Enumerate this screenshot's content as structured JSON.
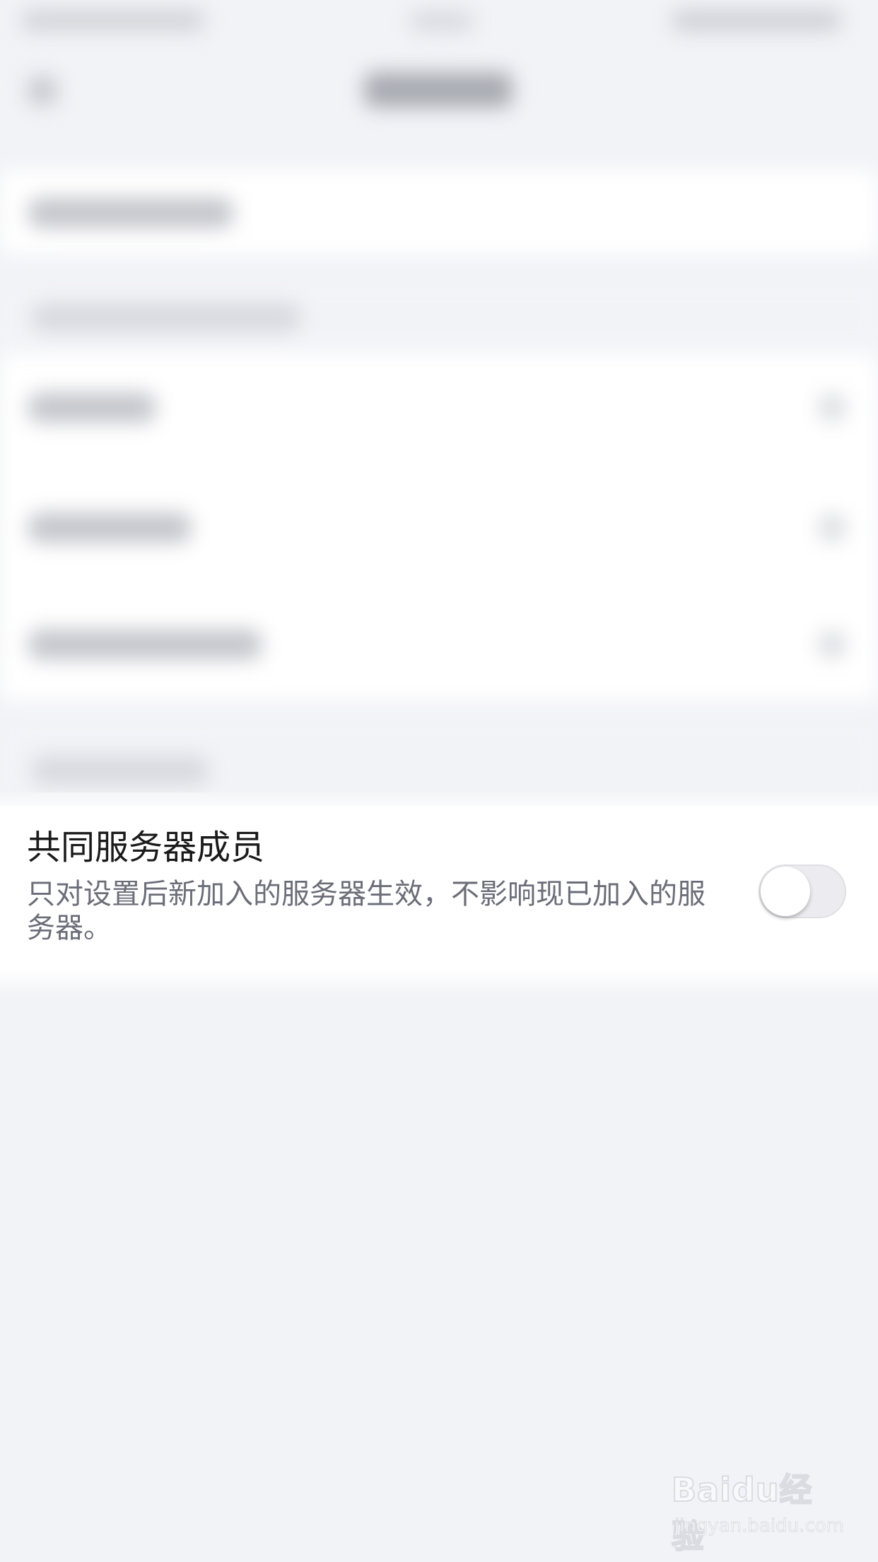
{
  "settings_row": {
    "title": "共同服务器成员",
    "description": "只对设置后新加入的服务器生效，不影响现已加入的服务器。",
    "toggle_state": "off"
  },
  "watermark": {
    "logo_text": "Baidu经验",
    "url_text": "jingyan.baidu.com"
  },
  "colors": {
    "page_background": "#f2f3f7",
    "card_background": "#ffffff",
    "title_text": "#1a1a1a",
    "description_text": "#6b6e78",
    "toggle_off_track": "#ececf0"
  }
}
